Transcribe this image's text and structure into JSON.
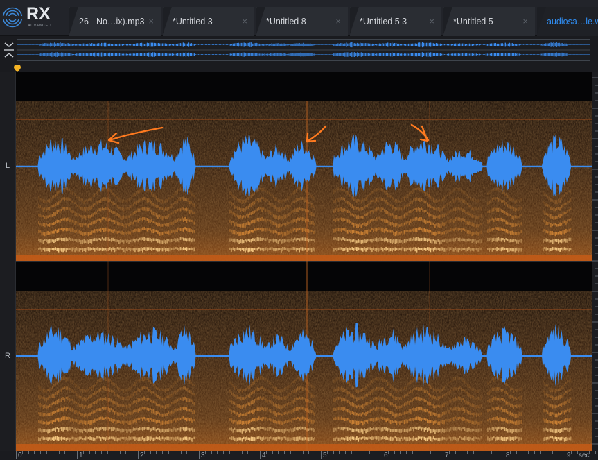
{
  "app": {
    "logo_text": "RX",
    "logo_subtitle": "ADVANCED"
  },
  "tabs": [
    {
      "label": "26 - No…ix).mp3",
      "active": false
    },
    {
      "label": "*Untitled 3",
      "active": false
    },
    {
      "label": "*Untitled 8",
      "active": false
    },
    {
      "label": "*Untitled 5 3",
      "active": false
    },
    {
      "label": "*Untitled 5",
      "active": false
    },
    {
      "label": "audiosa…le.w",
      "active": true
    }
  ],
  "tab_close_glyph": "×",
  "channels": {
    "left_label": "L",
    "right_label": "R"
  },
  "time_axis": {
    "ticks": [
      "0",
      "1",
      "2",
      "3",
      "4",
      "5",
      "6",
      "7",
      "8",
      "9"
    ],
    "unit": "sec"
  },
  "colors": {
    "waveform": "#3a8cf0",
    "spectrogram_low": "#1a0d04",
    "spectrogram_high": "#ffd27a",
    "annotation": "#ff7a1f",
    "active_tab": "#2f8cf0"
  },
  "icons": {
    "overview_toggle": "collapse-expand-icon",
    "playhead": "playhead-marker-icon",
    "logo": "rx-logo-icon"
  }
}
